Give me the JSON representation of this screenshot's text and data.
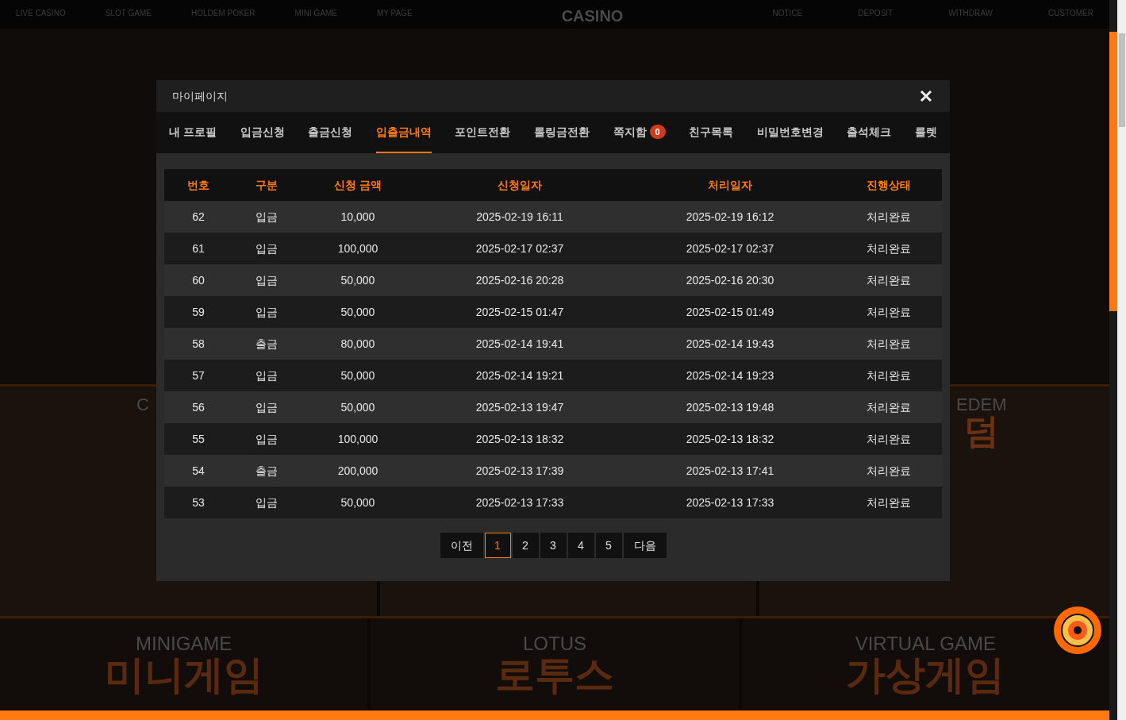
{
  "nav": {
    "left_items": [
      "LIVE CASINO",
      "SLOT GAME",
      "HOLDEM POKER",
      "MINI GAME",
      "MY PAGE"
    ],
    "logo": "CASINO",
    "right_items": [
      "NOTICE",
      "DEPOSIT",
      "WITHDRAW",
      "CUSTOMER"
    ]
  },
  "background_cards": {
    "middle_row": [
      {
        "title": "C"
      },
      {
        "title": "EDEM",
        "korean": "덤"
      }
    ],
    "bottom_row": [
      {
        "title": "MINIGAME",
        "korean": "미니게임"
      },
      {
        "title": "LOTUS",
        "korean": "로투스"
      },
      {
        "title": "VIRTUAL GAME",
        "korean": "가상게임"
      }
    ]
  },
  "modal": {
    "title": "마이페이지",
    "tabs": [
      {
        "label": "내 프로필",
        "selected": false
      },
      {
        "label": "입금신청",
        "selected": false
      },
      {
        "label": "출금신청",
        "selected": false
      },
      {
        "label": "입출금내역",
        "selected": true
      },
      {
        "label": "포인트전환",
        "selected": false
      },
      {
        "label": "롤링금전환",
        "selected": false
      },
      {
        "label": "쪽지함",
        "selected": false,
        "badge": "0"
      },
      {
        "label": "친구목록",
        "selected": false
      },
      {
        "label": "비밀번호변경",
        "selected": false
      },
      {
        "label": "출석체크",
        "selected": false
      },
      {
        "label": "룰렛",
        "selected": false
      }
    ],
    "table": {
      "columns": [
        "번호",
        "구분",
        "신청 금액",
        "신청일자",
        "처리일자",
        "진행상태"
      ],
      "rows": [
        [
          "62",
          "입금",
          "10,000",
          "2025-02-19 16:11",
          "2025-02-19 16:12",
          "처리완료"
        ],
        [
          "61",
          "입금",
          "100,000",
          "2025-02-17 02:37",
          "2025-02-17 02:37",
          "처리완료"
        ],
        [
          "60",
          "입금",
          "50,000",
          "2025-02-16 20:28",
          "2025-02-16 20:30",
          "처리완료"
        ],
        [
          "59",
          "입금",
          "50,000",
          "2025-02-15 01:47",
          "2025-02-15 01:49",
          "처리완료"
        ],
        [
          "58",
          "출금",
          "80,000",
          "2025-02-14 19:41",
          "2025-02-14 19:43",
          "처리완료"
        ],
        [
          "57",
          "입금",
          "50,000",
          "2025-02-14 19:21",
          "2025-02-14 19:23",
          "처리완료"
        ],
        [
          "56",
          "입금",
          "50,000",
          "2025-02-13 19:47",
          "2025-02-13 19:48",
          "처리완료"
        ],
        [
          "55",
          "입금",
          "100,000",
          "2025-02-13 18:32",
          "2025-02-13 18:32",
          "처리완료"
        ],
        [
          "54",
          "출금",
          "200,000",
          "2025-02-13 17:39",
          "2025-02-13 17:41",
          "처리완료"
        ],
        [
          "53",
          "입금",
          "50,000",
          "2025-02-13 17:33",
          "2025-02-13 17:33",
          "처리완료"
        ]
      ]
    },
    "pagination": {
      "prev": "이전",
      "pages": [
        {
          "label": "1",
          "selected": true
        },
        {
          "label": "2",
          "selected": false
        },
        {
          "label": "3",
          "selected": false
        },
        {
          "label": "4",
          "selected": false
        },
        {
          "label": "5",
          "selected": false
        }
      ],
      "next": "다음"
    }
  }
}
